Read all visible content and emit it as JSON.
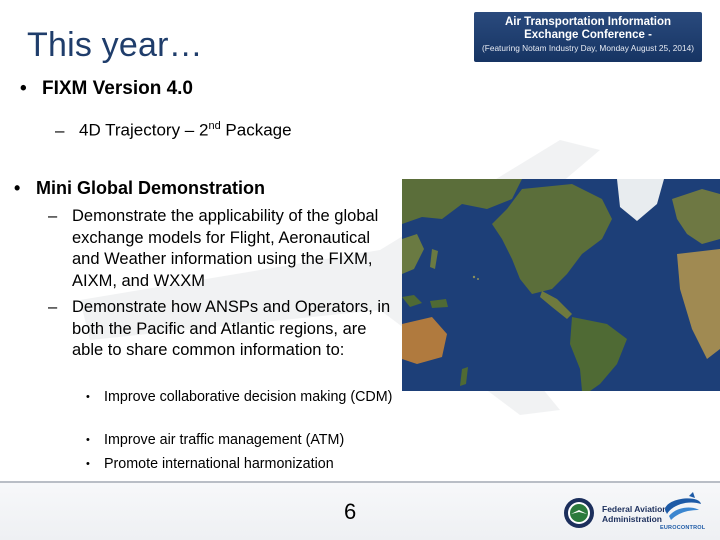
{
  "slide": {
    "title": "This year…",
    "page_number": "6"
  },
  "banner": {
    "line1": "Air Transportation Information",
    "line2": "Exchange Conference -",
    "line3": "(Featuring Notam Industry Day, Monday August 25, 2014)"
  },
  "bullets": [
    {
      "marker": "•",
      "text": "FIXM Version 4.0",
      "subitems": [
        {
          "marker": "–",
          "text_before": "4D Trajectory – 2",
          "sup": "nd",
          "text_after": " Package"
        }
      ]
    },
    {
      "marker": "•",
      "text": "Mini Global Demonstration",
      "subitems": [
        {
          "marker": "–",
          "text": "Demonstrate the applicability of the global exchange models for Flight, Aeronautical and Weather information using the FIXM, AIXM, and WXXM"
        },
        {
          "marker": "–",
          "text": "Demonstrate how ANSPs and Operators, in both the Pacific and Atlantic regions, are able to share common information to:",
          "subitems": [
            {
              "marker": "•",
              "text": "Improve collaborative decision making (CDM)"
            },
            {
              "marker": "•",
              "text": "Improve air traffic management (ATM)"
            },
            {
              "marker": "•",
              "text": "Promote international harmonization"
            }
          ]
        }
      ]
    }
  ],
  "footer": {
    "faa_line1": "Federal Aviation",
    "faa_line2": "Administration",
    "eurocontrol": "EUROCONTROL"
  },
  "colors": {
    "title": "#1f3d6b",
    "banner_bg": "#163463",
    "ocean": "#1d3f78",
    "land": "#5b6e3a"
  },
  "icons": {
    "faa": "faa-seal-icon",
    "eurocontrol": "eurocontrol-logo-icon",
    "map": "world-map-image"
  }
}
